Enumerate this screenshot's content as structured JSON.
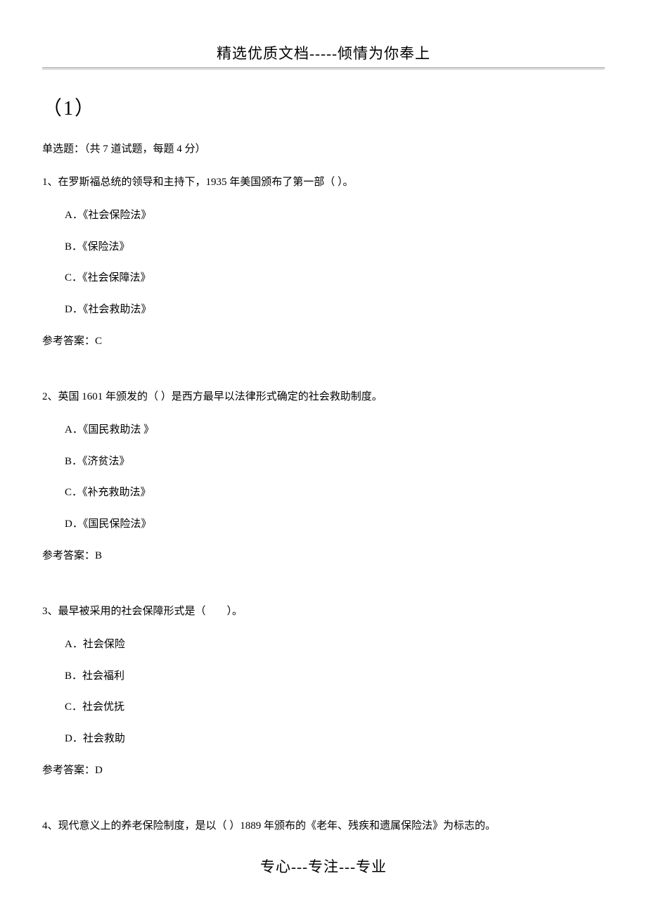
{
  "header": "精选优质文档-----倾情为你奉上",
  "section_number": "（1）",
  "section_instruction": "单选题：（共 7 道试题，每题 4 分）",
  "questions": [
    {
      "stem": "1、在罗斯福总统的领导和主持下，1935 年美国颁布了第一部（ ）。",
      "options": [
        "A．《社会保险法》",
        "B．《保险法》",
        "C．《社会保障法》",
        "D．《社会救助法》"
      ],
      "answer": "参考答案：C"
    },
    {
      "stem": "2、英国 1601 年颁发的（ ）是西方最早以法律形式确定的社会救助制度。",
      "options": [
        "A．《国民救助法 》",
        "B．《济贫法》",
        "C．《补充救助法》",
        "D．《国民保险法》"
      ],
      "answer": "参考答案：B"
    },
    {
      "stem": "3、最早被采用的社会保障形式是（　　）。",
      "options": [
        "A．社会保险",
        "B．社会福利",
        "C．社会优抚",
        "D．社会救助"
      ],
      "answer": "参考答案：D"
    },
    {
      "stem": "4、现代意义上的养老保险制度，是以（ ）1889 年颁布的《老年、残疾和遗属保险法》为标志的。"
    }
  ],
  "footer": "专心---专注---专业"
}
